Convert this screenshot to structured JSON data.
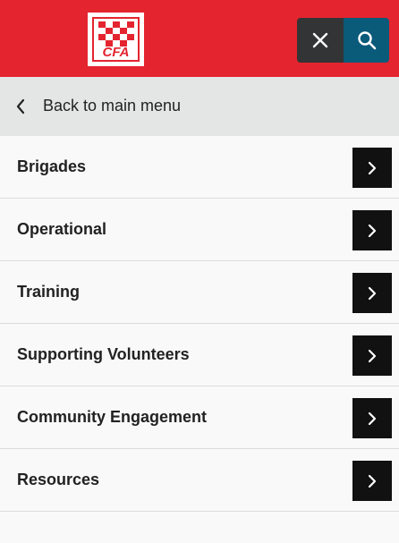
{
  "header": {
    "logo_text": "CFA",
    "brand_color": "#e4242f",
    "close_color": "#333435",
    "search_color": "#0a5a7a",
    "close_icon": "close-icon",
    "search_icon": "search-icon"
  },
  "back": {
    "label": "Back to main menu",
    "icon": "chevron-left-icon"
  },
  "menu": {
    "items": [
      {
        "label": "Brigades"
      },
      {
        "label": "Operational"
      },
      {
        "label": "Training"
      },
      {
        "label": "Supporting Volunteers"
      },
      {
        "label": "Community Engagement"
      },
      {
        "label": "Resources"
      }
    ],
    "arrow_icon": "chevron-right-icon"
  }
}
